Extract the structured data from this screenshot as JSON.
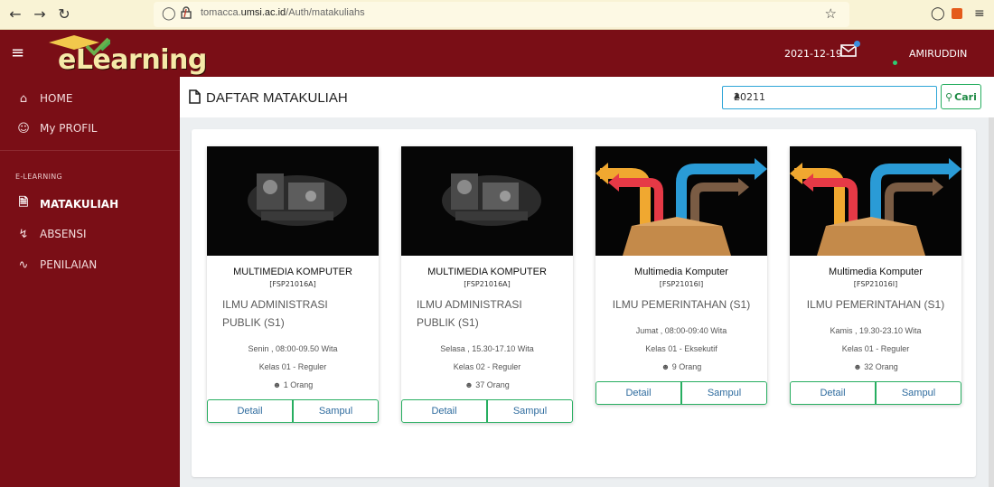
{
  "browser": {
    "url_prefix": "tomacca.",
    "url_domain": "umsi.ac.id",
    "url_path": "/Auth/matakuliahs"
  },
  "topbar": {
    "logo_text": "eLearning",
    "date": "2021-12-19",
    "username": "AMIRUDDIN"
  },
  "sidebar": {
    "items": [
      {
        "label": "HOME",
        "icon": "home-icon"
      },
      {
        "label": "My PROFIL",
        "icon": "user-icon"
      }
    ],
    "section_heading": "E-LEARNING",
    "section_items": [
      {
        "label": "MATAKULIAH",
        "icon": "file-icon",
        "active": true
      },
      {
        "label": "ABSENSI",
        "icon": "bolt-icon",
        "active": false
      },
      {
        "label": "PENILAIAN",
        "icon": "activity-icon",
        "active": false
      }
    ]
  },
  "header": {
    "title": "DAFTAR MATAKULIAH",
    "semester_value": "20211",
    "search_label": "Cari"
  },
  "courses": [
    {
      "name": "MULTIMEDIA KOMPUTER",
      "code": "[FSP21016A]",
      "program": "ILMU ADMINISTRASI PUBLIK (S1)",
      "schedule": "Senin , 08:00-09.50 Wita",
      "class": "Kelas 01 - Reguler",
      "students": "1 Orang",
      "detail": "Detail",
      "cover": "Sampul",
      "image": "robot"
    },
    {
      "name": "MULTIMEDIA KOMPUTER",
      "code": "[FSP21016A]",
      "program": "ILMU ADMINISTRASI PUBLIK (S1)",
      "schedule": "Selasa , 15.30-17.10 Wita",
      "class": "Kelas 02 - Reguler",
      "students": "37 Orang",
      "detail": "Detail",
      "cover": "Sampul",
      "image": "robot"
    },
    {
      "name": "Multimedia Komputer",
      "code": "[FSP21016I]",
      "program": "ILMU PEMERINTAHAN (S1)",
      "schedule": "Jumat , 08:00-09:40 Wita",
      "class": "Kelas 01 - Eksekutif",
      "students": "9 Orang",
      "detail": "Detail",
      "cover": "Sampul",
      "image": "box-arrows"
    },
    {
      "name": "Multimedia Komputer",
      "code": "[FSP21016I]",
      "program": "ILMU PEMERINTAHAN (S1)",
      "schedule": "Kamis , 19.30-23.10 Wita",
      "class": "Kelas 01 - Reguler",
      "students": "32 Orang",
      "detail": "Detail",
      "cover": "Sampul",
      "image": "box-arrows"
    }
  ]
}
